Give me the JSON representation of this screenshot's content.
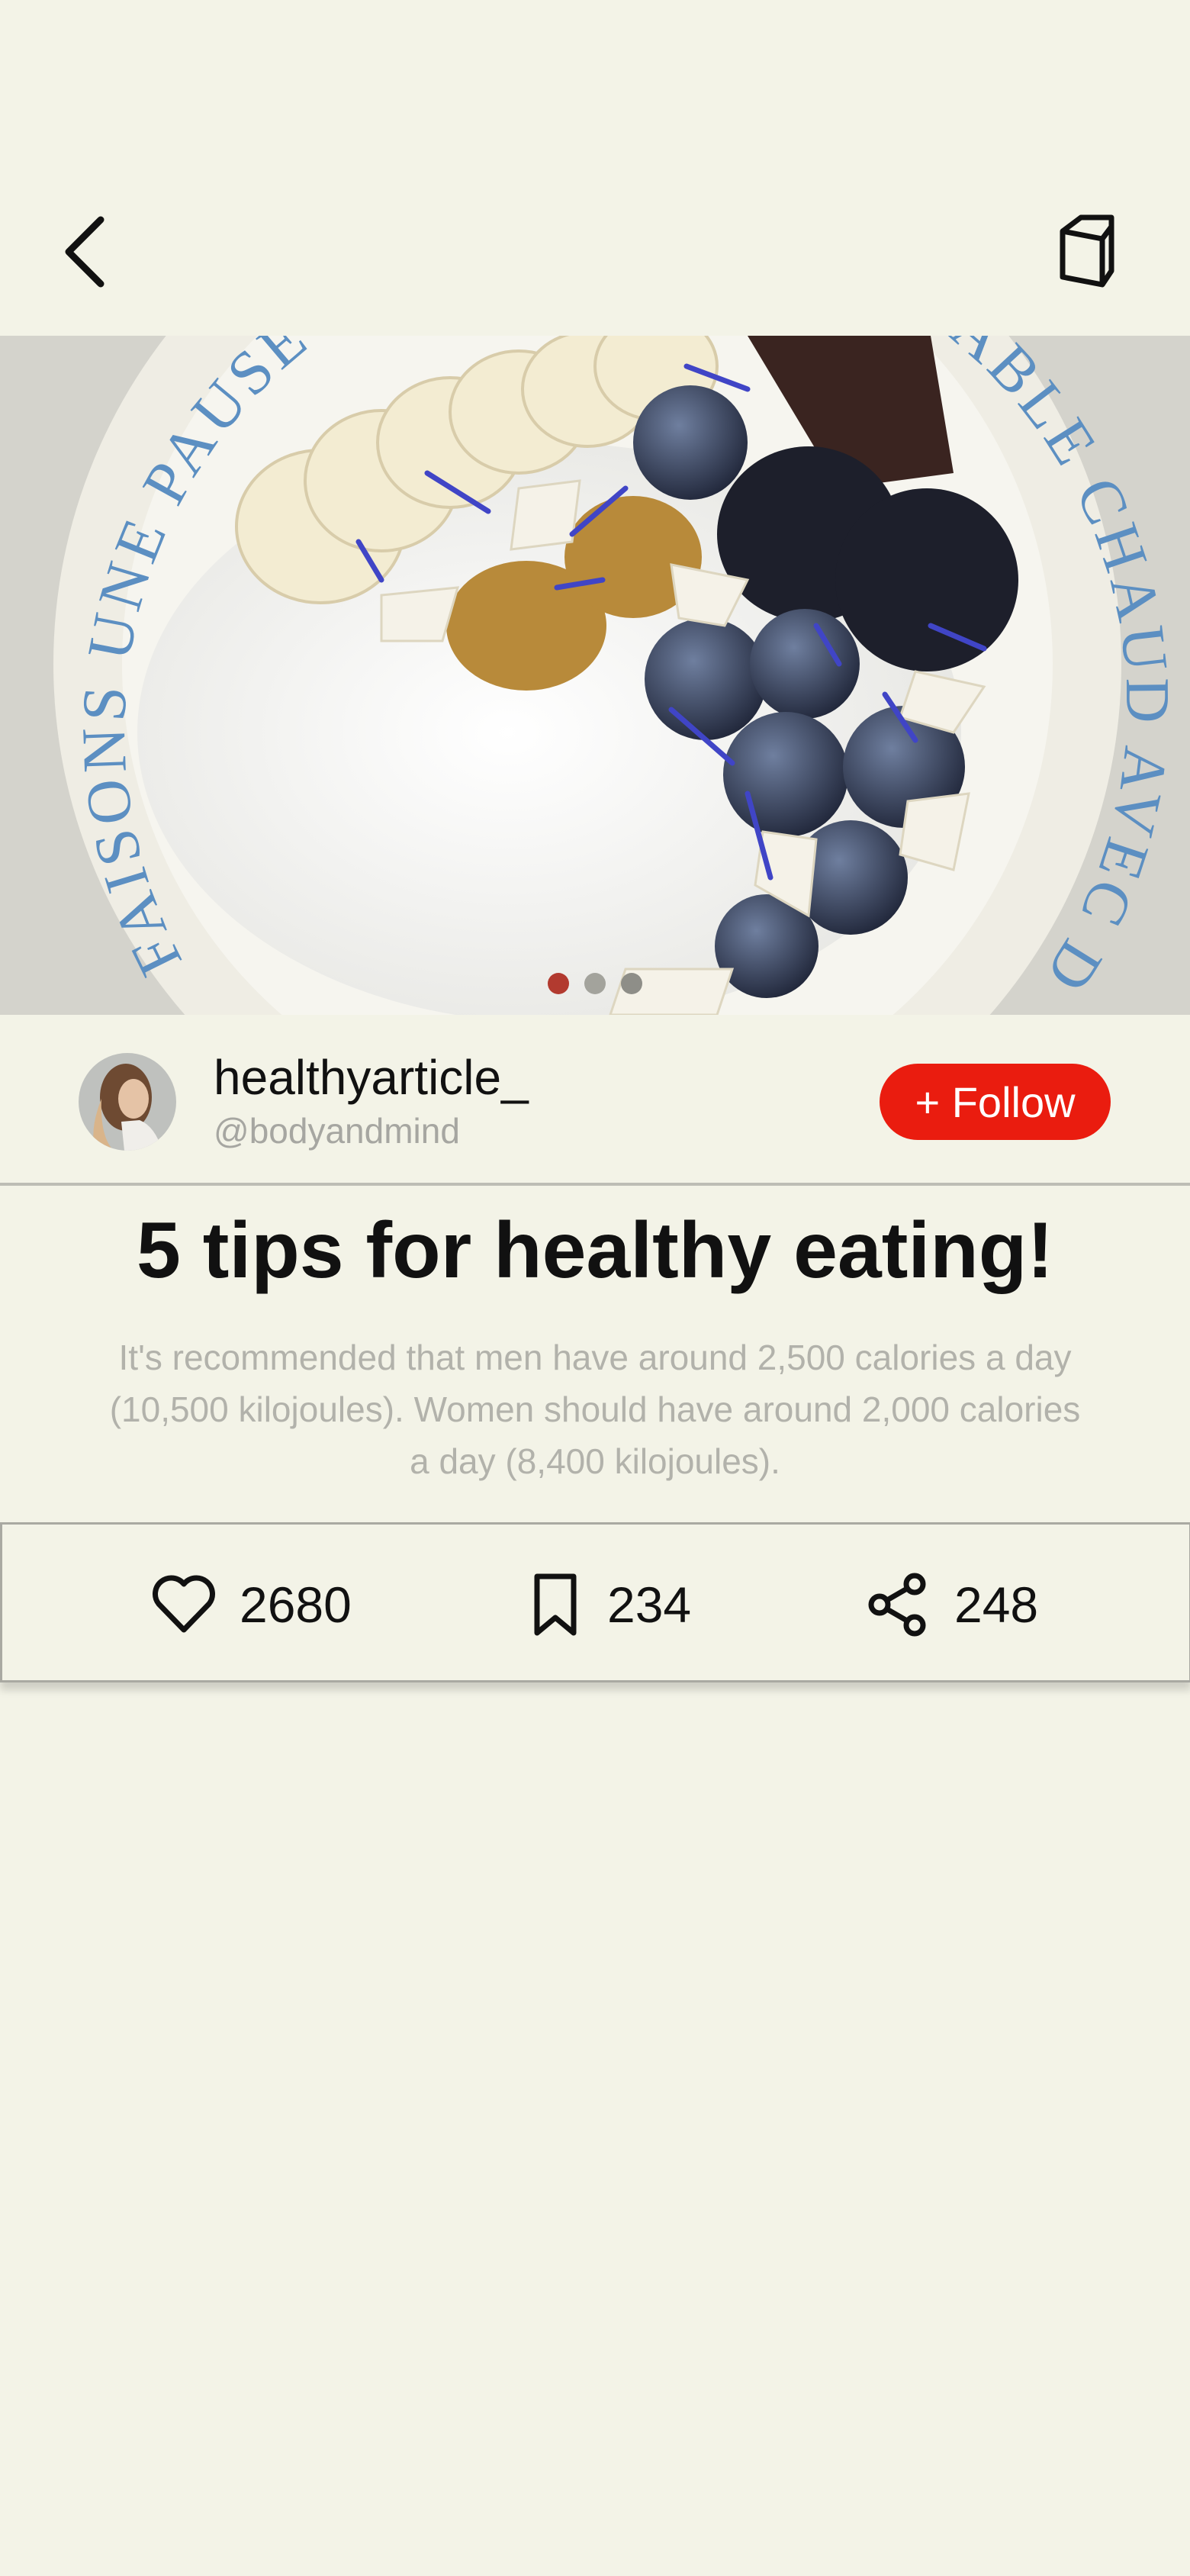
{
  "header": {
    "back_icon": "chevron-left-icon",
    "book_icon": "book-icon"
  },
  "hero": {
    "plate_text_left": "FAISONS UNE PAUSE",
    "plate_text_right": "SABLE CHAUD AVEC D",
    "slide_count": 3,
    "active_slide": 1,
    "colors": {
      "active_dot": "#b23a2f",
      "inactive_dot": "#9a9a94"
    }
  },
  "author": {
    "name": "healthyarticle_",
    "handle": "@bodyandmind",
    "follow_label": "+ Follow"
  },
  "article": {
    "title": "5 tips for healthy eating!",
    "description": "It's recommended that men have around 2,500 calories a day (10,500 kilojoules). Women should have around 2,000 calories a day (8,400 kilojoules)."
  },
  "actions": {
    "likes": "2680",
    "saves": "234",
    "shares": "248"
  },
  "colors": {
    "background": "#f3f3e7",
    "accent": "#ea1c0f"
  }
}
